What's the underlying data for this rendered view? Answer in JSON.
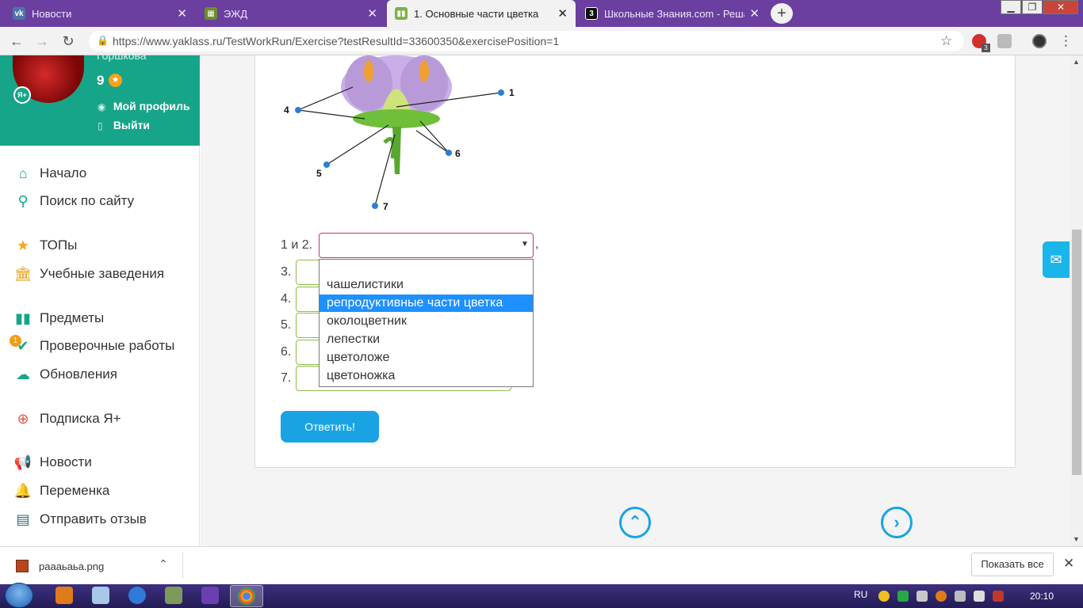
{
  "browser": {
    "tabs": [
      {
        "title": "Новости",
        "favicon": "vk-icon",
        "color": "#4a76a8"
      },
      {
        "title": "ЭЖД",
        "favicon": "document-icon",
        "color": "#6b8e23"
      },
      {
        "title": "1. Основные части цветка",
        "favicon": "yaklass-icon",
        "color": "#7cb342"
      },
      {
        "title": "Школьные Знания.com - Решае",
        "favicon": "znanija-icon",
        "color": "#222222"
      }
    ],
    "new_tab": "+",
    "url": "https://www.yaklass.ru/TestWorkRun/Exercise?testResultId=33600350&exercisePosition=1",
    "ext_badge": "3"
  },
  "profile": {
    "name": "Горшкова",
    "points": "9",
    "my_profile": "Мой профиль",
    "logout": "Выйти",
    "avatar_badge": "Я+"
  },
  "nav": [
    {
      "label": "Начало",
      "icon": "home-icon"
    },
    {
      "label": "Поиск по сайту",
      "icon": "search-icon"
    },
    {
      "label": "ТОПы",
      "icon": "star-icon"
    },
    {
      "label": "Учебные заведения",
      "icon": "school-icon"
    },
    {
      "label": "Предметы",
      "icon": "books-icon"
    },
    {
      "label": "Проверочные работы",
      "icon": "check-icon",
      "badge": "1"
    },
    {
      "label": "Обновления",
      "icon": "updates-icon"
    },
    {
      "label": "Подписка Я+",
      "icon": "subscription-icon"
    },
    {
      "label": "Новости",
      "icon": "news-icon"
    },
    {
      "label": "Переменка",
      "icon": "bell-icon"
    },
    {
      "label": "Отправить отзыв",
      "icon": "feedback-icon"
    }
  ],
  "diagram": {
    "labels": [
      "1",
      "4",
      "5",
      "6",
      "7"
    ]
  },
  "question": {
    "rows": [
      "1 и 2.",
      "3.",
      "4.",
      "5.",
      "6.",
      "7."
    ],
    "comma": ",",
    "dropdown_options": [
      "чашелистики",
      "репродуктивные части цветка",
      "околоцветник",
      "лепестки",
      "цветоложе",
      "цветоножка"
    ],
    "highlighted_option": "репродуктивные части цветка",
    "submit_label": "Ответить!"
  },
  "download": {
    "file": "раааьаьа.png",
    "show_all": "Показать все"
  },
  "taskbar": {
    "lang": "RU",
    "time": "20:10"
  }
}
